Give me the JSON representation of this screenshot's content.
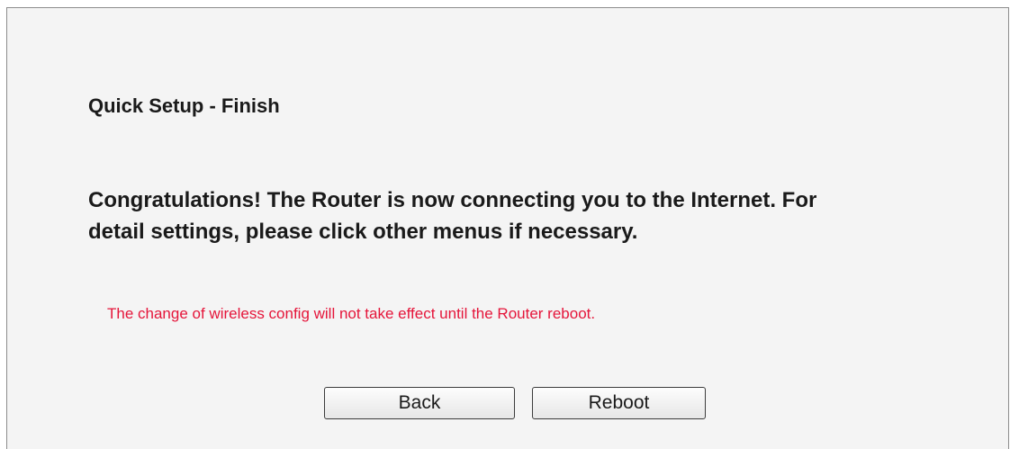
{
  "page": {
    "title": "Quick Setup - Finish",
    "message": "Congratulations! The Router is now connecting you to the Internet. For detail settings, please click other menus if necessary.",
    "notice": "The change of wireless config will not take effect until the Router reboot."
  },
  "buttons": {
    "back_label": "Back",
    "reboot_label": "Reboot"
  },
  "colors": {
    "notice": "#e5153a",
    "panel_background": "#f4f4f4"
  }
}
